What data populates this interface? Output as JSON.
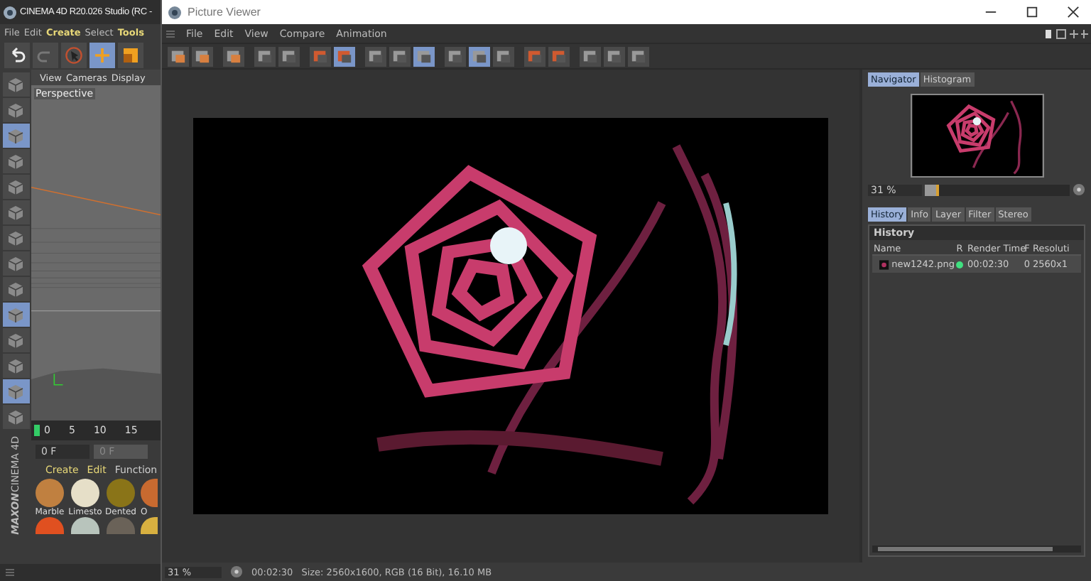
{
  "c4d": {
    "title": "CINEMA 4D R20.026 Studio (RC -",
    "menu": [
      {
        "label": "File",
        "highlight": false
      },
      {
        "label": "Edit",
        "highlight": false
      },
      {
        "label": "Create",
        "highlight": true
      },
      {
        "label": "Select",
        "highlight": false
      },
      {
        "label": "Tools",
        "highlight": true
      }
    ],
    "tools": [
      {
        "kind": "undo",
        "on": false
      },
      {
        "kind": "redo",
        "on": false
      },
      {
        "kind": "select",
        "on": false
      },
      {
        "kind": "move",
        "on": true
      },
      {
        "kind": "scale",
        "on": false
      }
    ],
    "side_icons": [
      {
        "on": false
      },
      {
        "on": false
      },
      {
        "on": true
      },
      {
        "on": false
      },
      {
        "on": false
      },
      {
        "on": false
      },
      {
        "on": false
      },
      {
        "on": false
      },
      {
        "on": false
      },
      {
        "on": true
      },
      {
        "on": false
      },
      {
        "on": false
      },
      {
        "on": true
      },
      {
        "on": false
      }
    ],
    "viewport": {
      "menu": [
        "View",
        "Cameras",
        "Display"
      ],
      "label": "Perspective"
    },
    "timeline": {
      "ticks": [
        "0",
        "5",
        "10",
        "15"
      ],
      "frame": "0 F",
      "frame_end": "0 F"
    },
    "materials_menu": [
      "Create",
      "Edit",
      "Function"
    ],
    "materials": [
      {
        "name": "Marble",
        "color": "#c08040"
      },
      {
        "name": "Limesto",
        "color": "#e6dfc8"
      },
      {
        "name": "Dented",
        "color": "#8a7418"
      },
      {
        "name": "O",
        "color": "#c86a30"
      }
    ],
    "materials_row_2": [
      {
        "color": "#e05020"
      },
      {
        "color": "#b8c4bc"
      },
      {
        "color": "#6a6258"
      },
      {
        "color": "#d8b040"
      }
    ],
    "logo": {
      "brand": "MAXON",
      "product": "CINEMA 4D"
    }
  },
  "pv": {
    "title": "Picture Viewer",
    "menu": [
      "File",
      "Edit",
      "View",
      "Compare",
      "Animation"
    ],
    "toolbar": [
      [
        {
          "on": false
        },
        {
          "on": false
        }
      ],
      [
        {
          "on": false
        }
      ],
      [
        {
          "on": false
        },
        {
          "on": false
        }
      ],
      [
        {
          "on": false
        },
        {
          "on": true
        }
      ],
      [
        {
          "on": false
        },
        {
          "on": false
        },
        {
          "on": true
        }
      ],
      [
        {
          "on": false
        },
        {
          "on": true
        },
        {
          "on": false
        }
      ],
      [
        {
          "on": false
        },
        {
          "on": false
        }
      ],
      [
        {
          "on": false
        },
        {
          "on": false
        },
        {
          "on": false
        }
      ]
    ],
    "navigator_tabs": [
      {
        "label": "Navigator",
        "selected": true
      },
      {
        "label": "Histogram",
        "selected": false
      }
    ],
    "zoom": {
      "value": "31 %",
      "level": 0.08
    },
    "tabs": [
      {
        "label": "History",
        "selected": true
      },
      {
        "label": "Info",
        "selected": false
      },
      {
        "label": "Layer",
        "selected": false
      },
      {
        "label": "Filter",
        "selected": false
      },
      {
        "label": "Stereo",
        "selected": false
      }
    ],
    "history": {
      "title": "History",
      "columns": [
        "Name",
        "R",
        "Render Time",
        "F",
        "Resoluti"
      ],
      "rows": [
        {
          "name": "new1242.png",
          "color": "#40e080",
          "render_time": "00:02:30",
          "frame": "0",
          "resolution": "2560x1"
        }
      ]
    },
    "status": {
      "zoom": "31 %",
      "time": "00:02:30",
      "info": "Size: 2560x1600, RGB (16 Bit), 16.10 MB"
    }
  }
}
